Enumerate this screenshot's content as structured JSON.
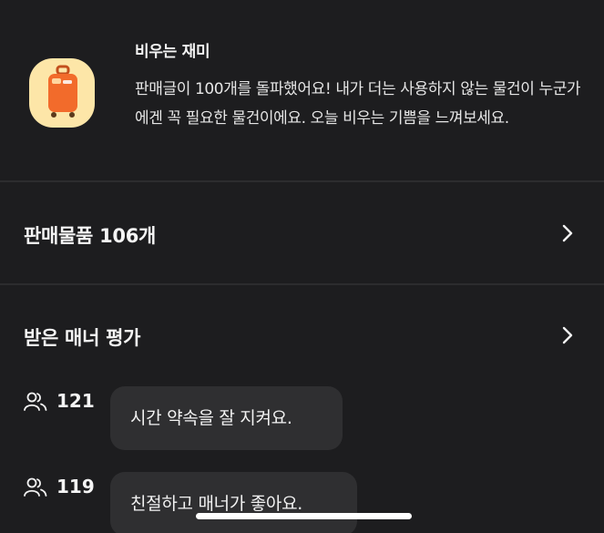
{
  "badge": {
    "icon": "suitcase-icon",
    "title": "비우는 재미",
    "description": "판매글이 100개를 돌파했어요! 내가 더는 사용하지 않는 물건이 누군가에겐 꼭 필요한 물건이에요. 오늘 비우는 기쁨을 느껴보세요."
  },
  "sales": {
    "label": "판매물품 106개"
  },
  "manner": {
    "label": "받은 매너 평가",
    "reviews": [
      {
        "count": "121",
        "text": "시간 약속을 잘 지켜요."
      },
      {
        "count": "119",
        "text": "친절하고 매너가 좋아요."
      }
    ]
  },
  "colors": {
    "background": "#1d1d1f",
    "bubble": "#2f2f31",
    "badge_bg": "#fde6a8",
    "suitcase": "#f26b2b"
  }
}
